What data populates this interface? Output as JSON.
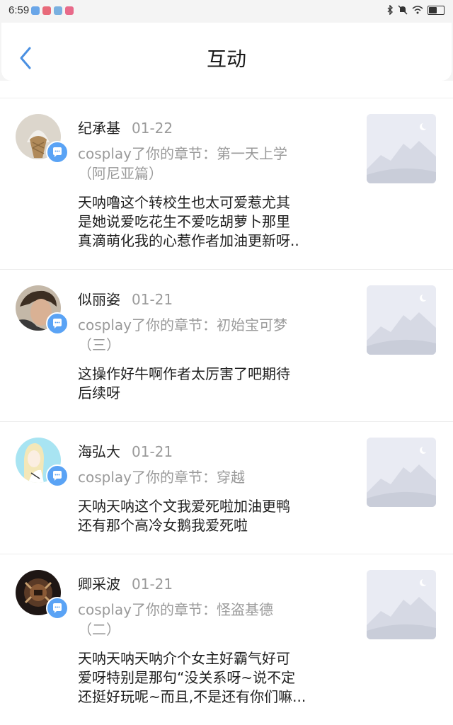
{
  "status_bar": {
    "time": "6:59",
    "notification_icons": [
      "app-icon",
      "app-icon",
      "app-icon",
      "app-icon"
    ],
    "right_icons": [
      "bluetooth-icon",
      "mute-icon",
      "wifi-icon",
      "battery-icon"
    ],
    "battery_level": 0.6
  },
  "header": {
    "title": "互动",
    "back_icon": "chevron-left-icon",
    "accent_color": "#4a90e2"
  },
  "items": [
    {
      "name": "纪承基",
      "date": "01-22",
      "ref_line1": "cosplay了你的章节：第一天上学",
      "ref_line2": "（阿尼亚篇）",
      "content_lines": [
        "天呐噜这个转校生也太可爱惹尤其",
        "是她说爱吃花生不爱吃胡萝卜那里",
        "真滴萌化我的心惹作者加油更新呀.."
      ],
      "avatar": "avatar-ice-cream",
      "thumbnail": "mountain-placeholder"
    },
    {
      "name": "似丽姿",
      "date": "01-21",
      "ref_line1": "cosplay了你的章节：初始宝可梦",
      "ref_line2": "（三）",
      "content_lines": [
        "这操作好牛啊作者太厉害了吧期待",
        "后续呀"
      ],
      "avatar": "avatar-person-photo",
      "thumbnail": "mountain-placeholder"
    },
    {
      "name": "海弘大",
      "date": "01-21",
      "ref_line1": "cosplay了你的章节：穿越",
      "ref_line2": "",
      "content_lines": [
        "天呐天呐这个文我爱死啦加油更鸭",
        "还有那个高冷女鹅我爱死啦"
      ],
      "avatar": "avatar-anime-girl",
      "thumbnail": "mountain-placeholder"
    },
    {
      "name": "卿采波",
      "date": "01-21",
      "ref_line1": "cosplay了你的章节：怪盗基德",
      "ref_line2": "（二）",
      "content_lines": [
        "天呐天呐天呐介个女主好霸气好可",
        "爱呀特别是那句“没关系呀~说不定",
        "还挺好玩呢~而且,不是还有你们嘛..."
      ],
      "avatar": "avatar-emblem",
      "thumbnail": "mountain-placeholder"
    }
  ],
  "colors": {
    "badge": "#5aa3f5",
    "muted_text": "#9a9a9a",
    "thumbnail_bg": "#e9ebf3"
  }
}
